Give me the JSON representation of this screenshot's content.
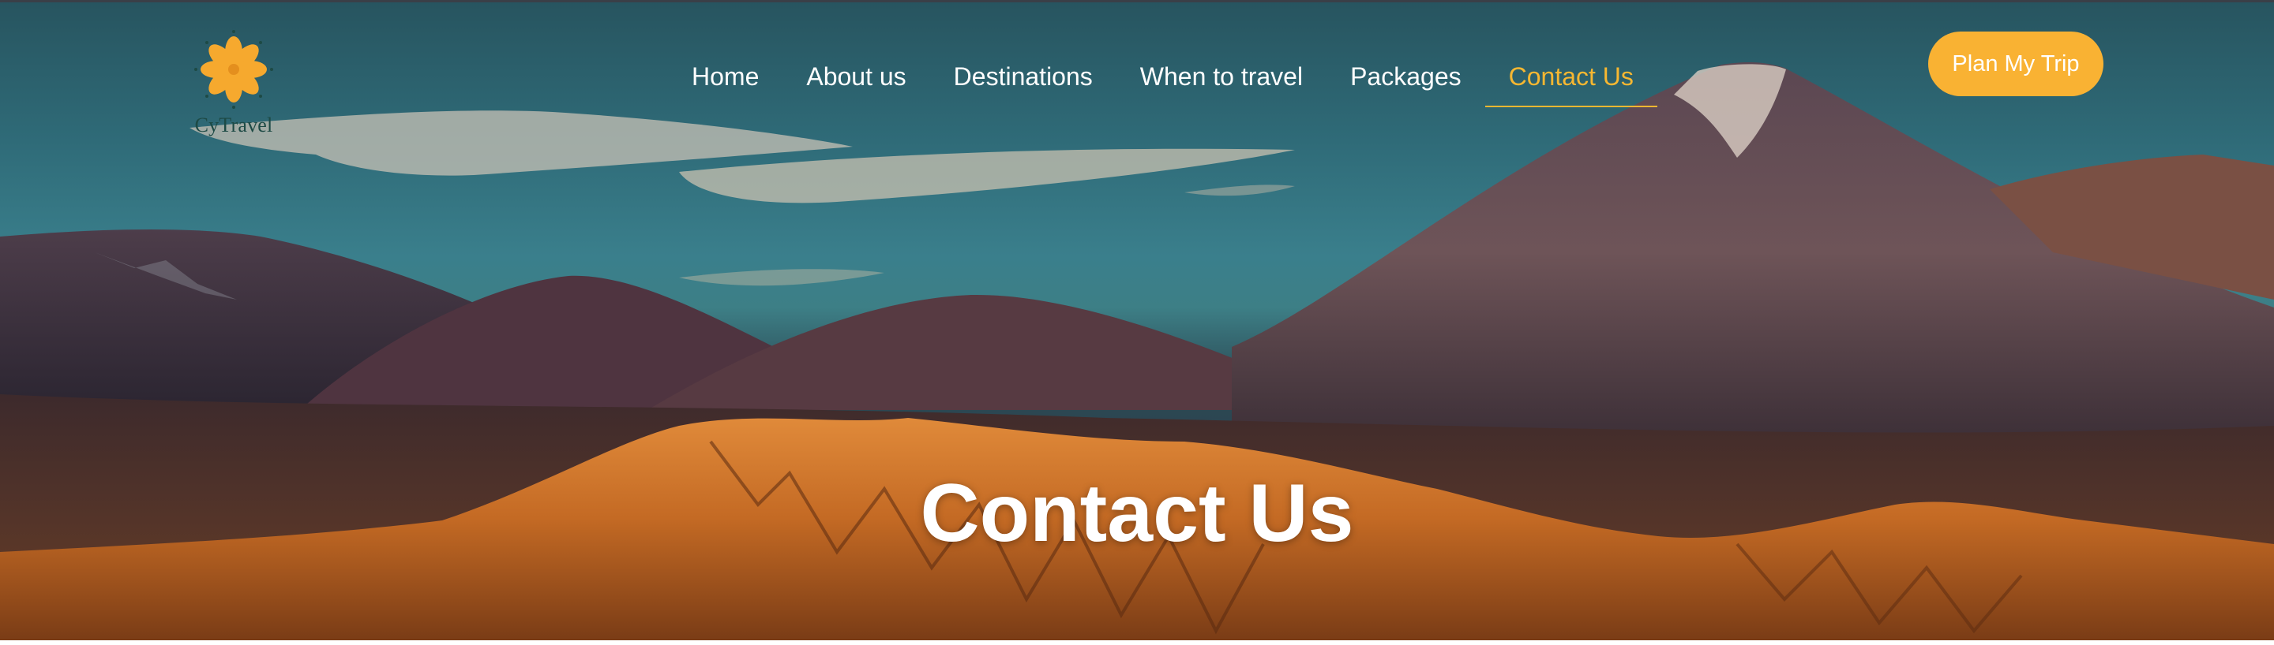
{
  "brand": {
    "name": "CyTravel",
    "color": "#f7b731"
  },
  "nav": {
    "items": [
      {
        "label": "Home"
      },
      {
        "label": "About us"
      },
      {
        "label": "Destinations"
      },
      {
        "label": "When to travel"
      },
      {
        "label": "Packages"
      },
      {
        "label": "Contact Us",
        "active": true
      }
    ],
    "active_color": "#f7b731"
  },
  "cta": {
    "label": "Plan My Trip",
    "color": "#f9b233"
  },
  "hero": {
    "title": "Contact Us",
    "background": "mountain-desert-landscape-photo"
  }
}
